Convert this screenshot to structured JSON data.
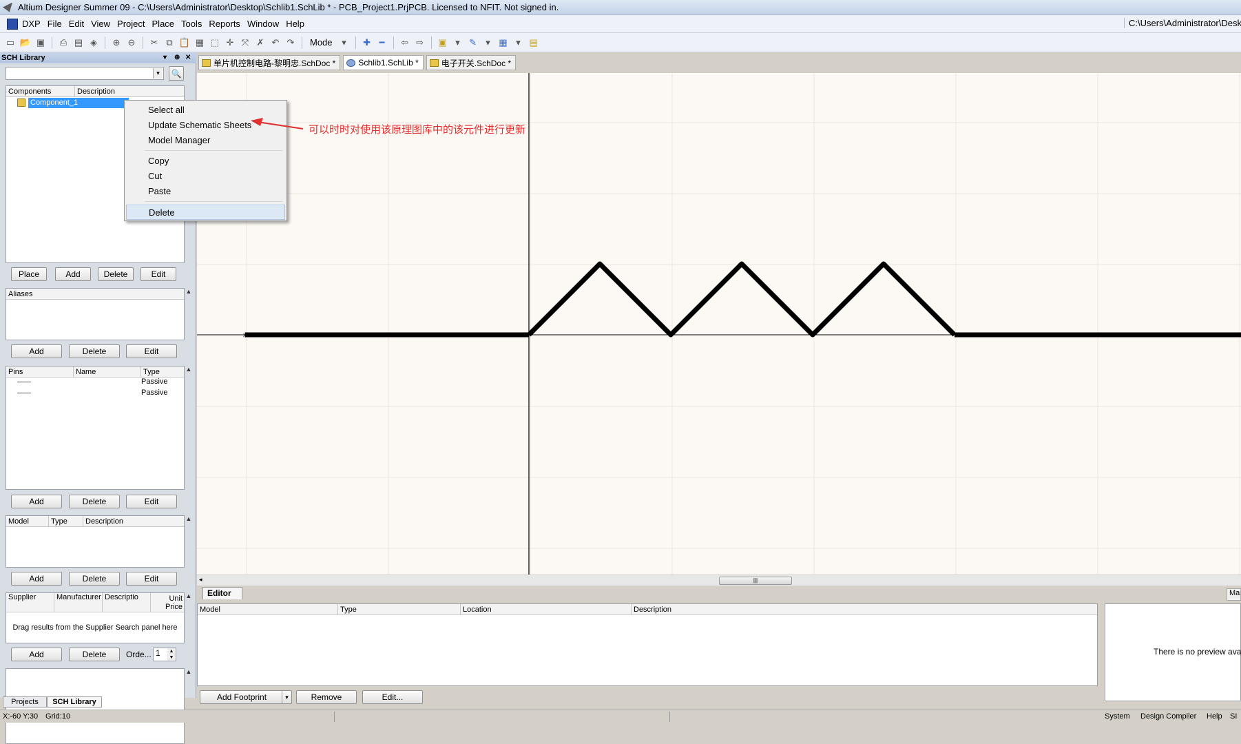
{
  "titlebar": {
    "title": "Altium Designer Summer 09 - C:\\Users\\Administrator\\Desktop\\Schlib1.SchLib * - PCB_Project1.PrjPCB. Licensed to NFIT. Not signed in."
  },
  "menubar": {
    "items": [
      "DXP",
      "File",
      "Edit",
      "View",
      "Project",
      "Place",
      "Tools",
      "Reports",
      "Window",
      "Help"
    ],
    "path": "C:\\Users\\Administrator\\Desk"
  },
  "toolbar": {
    "mode_label": "Mode"
  },
  "sch_library": {
    "title": "SCH Library",
    "components": {
      "headers": [
        "Components",
        "Description"
      ],
      "items": [
        "Component_1"
      ],
      "buttons": [
        "Place",
        "Add",
        "Delete",
        "Edit"
      ]
    },
    "aliases": {
      "header": "Aliases",
      "buttons": [
        "Add",
        "Delete",
        "Edit"
      ]
    },
    "pins": {
      "headers": [
        "Pins",
        "Name",
        "Type"
      ],
      "rows": [
        {
          "type": "Passive"
        },
        {
          "type": "Passive"
        }
      ],
      "buttons": [
        "Add",
        "Delete",
        "Edit"
      ]
    },
    "models": {
      "headers": [
        "Model",
        "Type",
        "Description"
      ],
      "buttons": [
        "Add",
        "Delete",
        "Edit"
      ]
    },
    "supplier": {
      "headers": [
        "Supplier",
        "Manufacturer",
        "Descriptio",
        "Unit Price"
      ],
      "hint": "Drag results from the Supplier Search panel here",
      "buttons": [
        "Add",
        "Delete"
      ],
      "order_label": "Orde...",
      "order_value": "1"
    },
    "bottom_tabs": [
      "Projects",
      "SCH Library"
    ]
  },
  "doc_tabs": [
    "单片机控制电路-黎明忠.SchDoc *",
    "Schlib1.SchLib *",
    "电子开关.SchDoc *"
  ],
  "context_menu": {
    "items": [
      "Select all",
      "Update Schematic Sheets",
      "Model Manager",
      "Copy",
      "Cut",
      "Paste",
      "Delete"
    ]
  },
  "annotation": {
    "text": "可以时时对使用该原理图库中的该元件进行更新",
    "color": "#e03030"
  },
  "editor": {
    "tab": "Editor",
    "headers": [
      "Model",
      "Type",
      "Location",
      "Description"
    ],
    "preview_text": "There is no preview availabl",
    "right_tab": "Mas",
    "buttons": {
      "add_footprint": "Add Footprint",
      "remove": "Remove",
      "edit": "Edit..."
    }
  },
  "status": {
    "coords": "X:-60 Y:30",
    "grid": "Grid:10",
    "panels": [
      "System",
      "Design Compiler",
      "Help",
      "SI"
    ]
  },
  "colors": {
    "selection": "#3399ff",
    "wire": "#000000",
    "canvas_bg": "#fcf8f3",
    "grid": "#ece6df"
  }
}
